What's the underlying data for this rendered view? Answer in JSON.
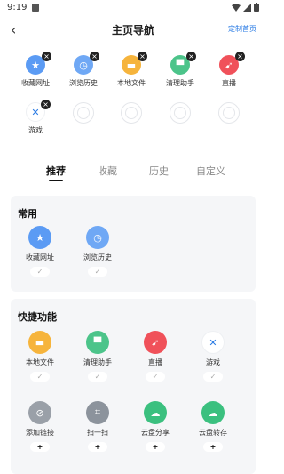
{
  "status_bar": {
    "time": "9:19"
  },
  "header": {
    "back_icon": "‹",
    "title": "主页导航",
    "action": "定制首页"
  },
  "pinned": [
    {
      "label": "收藏网址",
      "icon": "bookmark-icon",
      "color": "#5b9bf4",
      "glyph": "★"
    },
    {
      "label": "浏览历史",
      "icon": "clock-icon",
      "color": "#6fa8f5",
      "glyph": "◷"
    },
    {
      "label": "本地文件",
      "icon": "folder-icon",
      "color": "#f6b43c",
      "glyph": "▬"
    },
    {
      "label": "清理助手",
      "icon": "broom-icon",
      "color": "#4cc48a",
      "glyph": "▀"
    },
    {
      "label": "直播",
      "icon": "live-icon",
      "color": "#f0515a",
      "glyph": "➹"
    },
    {
      "label": "游戏",
      "icon": "game-icon",
      "color": "#ffffff",
      "glyph": "✕"
    }
  ],
  "tabs": [
    "推荐",
    "收藏",
    "历史",
    "自定义"
  ],
  "common": {
    "title": "常用",
    "items": [
      {
        "label": "收藏网址",
        "icon": "bookmark-icon",
        "color": "#5b9bf4",
        "glyph": "★",
        "state": "✓"
      },
      {
        "label": "浏览历史",
        "icon": "clock-icon",
        "color": "#6fa8f5",
        "glyph": "◷",
        "state": "✓"
      }
    ]
  },
  "shortcuts": {
    "title": "快捷功能",
    "items": [
      {
        "label": "本地文件",
        "icon": "folder-icon",
        "color": "#f6b43c",
        "glyph": "▬",
        "state": "✓"
      },
      {
        "label": "清理助手",
        "icon": "broom-icon",
        "color": "#4cc48a",
        "glyph": "▀",
        "state": "✓"
      },
      {
        "label": "直播",
        "icon": "live-icon",
        "color": "#f0515a",
        "glyph": "➹",
        "state": "✓"
      },
      {
        "label": "游戏",
        "icon": "game-icon",
        "color": "#ffffff",
        "glyph": "✕",
        "state": "✓"
      },
      {
        "label": "添加链接",
        "icon": "link-icon",
        "color": "#9aa0a8",
        "glyph": "⊘",
        "state": "+"
      },
      {
        "label": "扫一扫",
        "icon": "scan-icon",
        "color": "#8c939c",
        "glyph": "⌗",
        "state": "+"
      },
      {
        "label": "云盘分享",
        "icon": "cloud-share-icon",
        "color": "#3bc07f",
        "glyph": "☁",
        "state": "+"
      },
      {
        "label": "云盘转存",
        "icon": "cloud-save-icon",
        "color": "#3bc07f",
        "glyph": "☁",
        "state": "+"
      }
    ]
  }
}
